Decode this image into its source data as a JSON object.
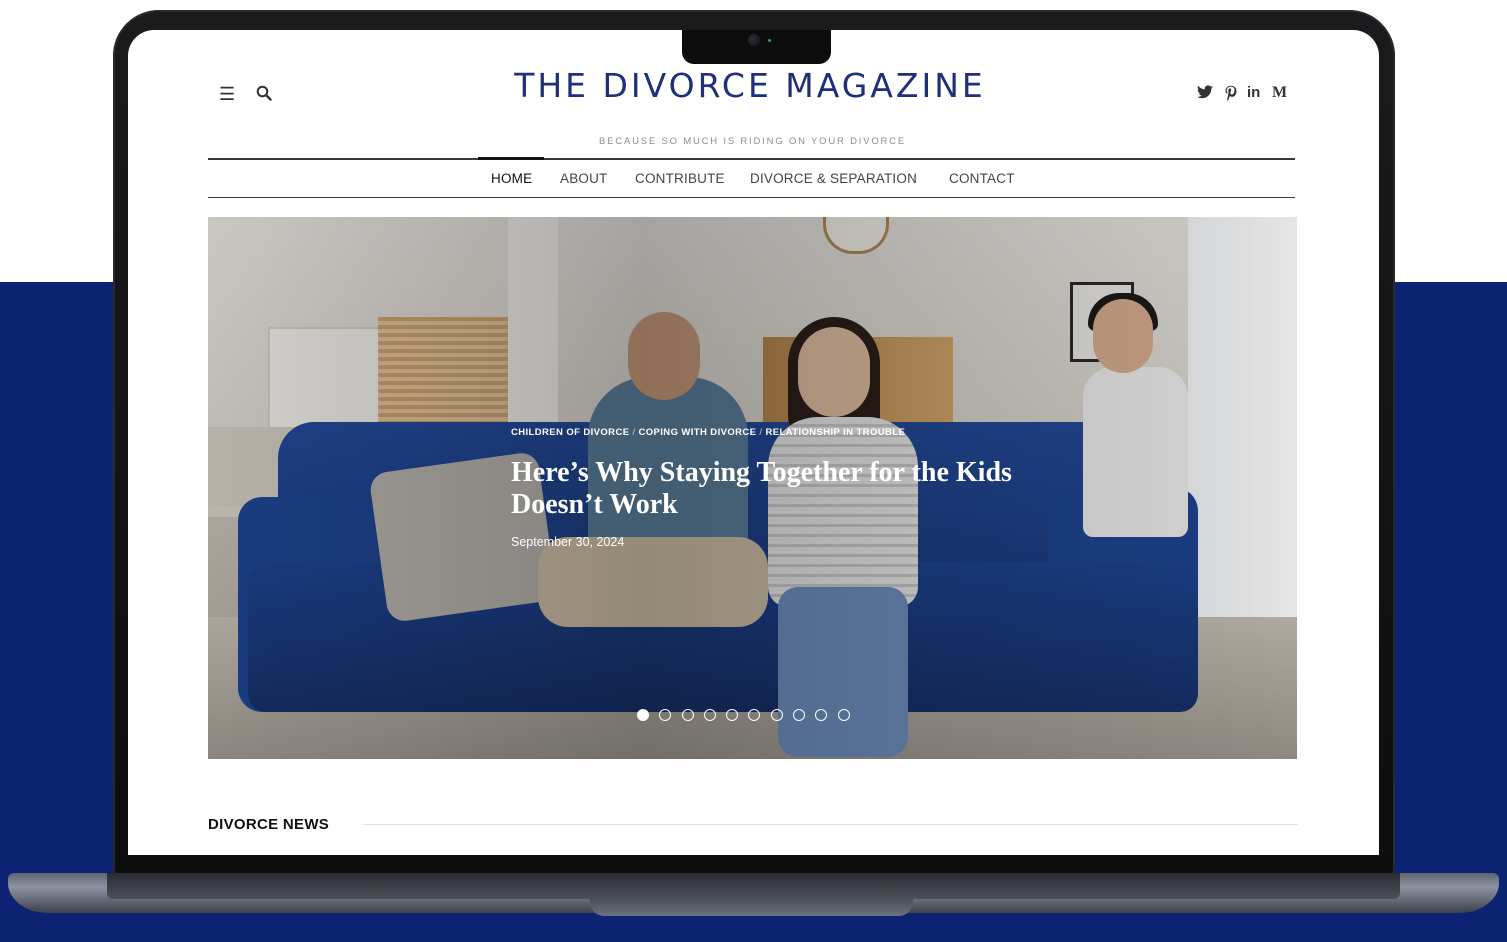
{
  "site": {
    "title": "THE DIVORCE MAGAZINE",
    "tagline": "BECAUSE SO MUCH IS RIDING ON YOUR DIVORCE",
    "brand_color": "#1f2f7a"
  },
  "header": {
    "menu_icon": "hamburger-menu-icon",
    "search_icon": "search-icon",
    "social": [
      {
        "name": "twitter-icon",
        "glyph": "🐦"
      },
      {
        "name": "pinterest-icon",
        "glyph": "P"
      },
      {
        "name": "linkedin-icon",
        "glyph": "in"
      },
      {
        "name": "medium-icon",
        "glyph": "M"
      }
    ]
  },
  "nav": {
    "items": [
      {
        "label": "HOME",
        "active": true
      },
      {
        "label": "ABOUT"
      },
      {
        "label": "CONTRIBUTE"
      },
      {
        "label": "DIVORCE & SEPARATION",
        "has_submenu": true
      },
      {
        "label": "CONTACT"
      }
    ],
    "submenu_indicator": "+"
  },
  "hero": {
    "categories": [
      "CHILDREN OF DIVORCE",
      "COPING WITH DIVORCE",
      "RELATIONSHIP IN TROUBLE"
    ],
    "category_separator": "/",
    "title": "Here’s Why Staying Together for the Kids Doesn’t Work",
    "date": "September 30, 2024",
    "slides_total": 10,
    "active_slide": 1
  },
  "section": {
    "title": "DIVORCE NEWS"
  },
  "colors": {
    "backdrop": "#0b2372",
    "nav_rule": "#3a3a3a"
  }
}
